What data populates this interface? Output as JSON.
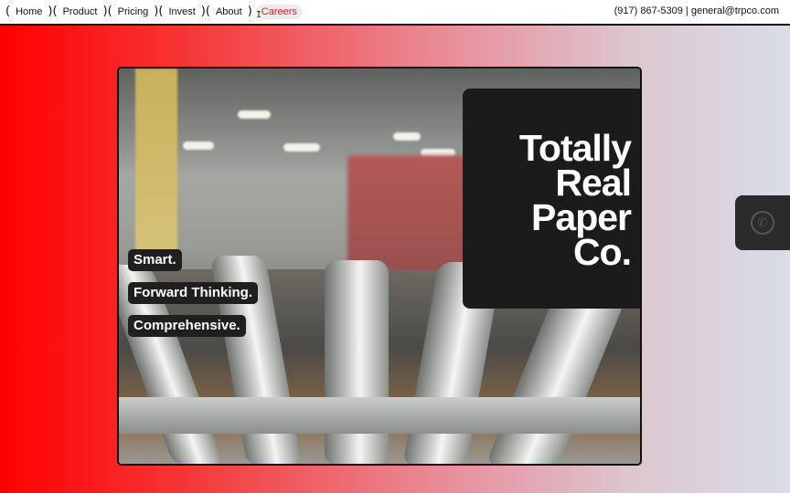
{
  "nav": {
    "items": [
      {
        "label": "Home"
      },
      {
        "label": "Product"
      },
      {
        "label": "Pricing"
      },
      {
        "label": "Invest"
      },
      {
        "label": "About"
      },
      {
        "label": "Careers"
      }
    ],
    "active_index": 5,
    "active_color": "#e02222"
  },
  "contact": {
    "text": "(917) 867-5309 | general@trpco.com"
  },
  "hero": {
    "tags": [
      "Smart.",
      "Forward Thinking.",
      "Comprehensive."
    ],
    "title_lines": [
      "Totally",
      "Real",
      "Paper",
      "Co."
    ]
  },
  "phone_button": {
    "icon": "phone-icon"
  },
  "colors": {
    "gradient_start": "#ff0000",
    "gradient_end": "#d9dde6",
    "card": "#1b1b1b"
  }
}
